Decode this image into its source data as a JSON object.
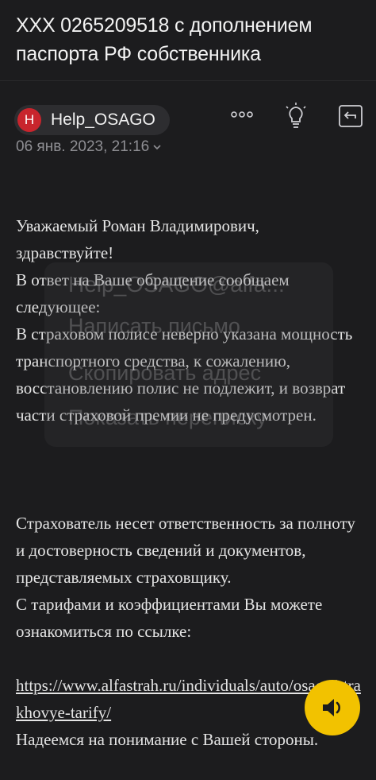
{
  "header": {
    "subject": "ХХХ 0265209518 с дополнением паспорта РФ собственника"
  },
  "sender": {
    "avatar_letter": "Н",
    "name": "Help_OSAGO",
    "date": "06 янв. 2023, 21:16"
  },
  "toolbar": {
    "more_icon": "more-dots-icon",
    "summary_icon": "lightbulb-icon",
    "reply_icon": "reply-icon"
  },
  "message": {
    "p1": "Уважаемый Роман Владимирович,\nздравствуйте!\nВ ответ на Ваше обращение сообщаем следующее:\nВ страховом полисе неверно указана мощность транспортного средства, к сожалению, восстановлению полис не подлежит, и возврат части страховой премии не предусмотрен.",
    "p2": "Страхователь несет ответственность за полноту и достоверность сведений и документов, представляемых страховщику.\nС тарифами и коэффициентами Вы можете ознакомиться по ссылке:",
    "link": "https://www.alfastrah.ru/individuals/auto/osago/strakhovye-tarify/",
    "p3": "Надеемся на понимание с Вашей стороны."
  },
  "context_menu": {
    "address": "Help_OSAGO@alfa...",
    "write": "Написать письмо",
    "copy": "Скопировать адрес",
    "show": "Показать переписку"
  },
  "colors": {
    "background": "#1c1c1e",
    "avatar": "#c8252d",
    "audio_button": "#f2c200"
  },
  "audio": {
    "icon": "speaker-icon"
  }
}
